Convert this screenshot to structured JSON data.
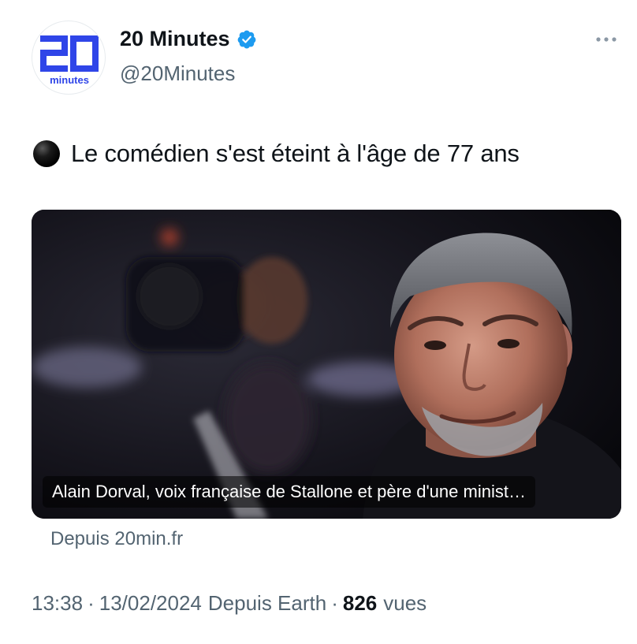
{
  "header": {
    "display_name": "20 Minutes",
    "handle": "@20Minutes",
    "avatar": {
      "logo_number": "20",
      "logo_word": "minutes",
      "brand_color": "#2f45e8"
    },
    "verified_icon": "verified-badge-icon",
    "more_icon": "more-options-icon"
  },
  "tweet": {
    "emoji": "black-circle",
    "text": "Le comédien s'est éteint à l'âge de 77 ans"
  },
  "card": {
    "caption": "Alain Dorval, voix française de Stallone et père d'une minist…",
    "source": "Depuis 20min.fr"
  },
  "meta": {
    "time": "13:38",
    "date": "13/02/2024",
    "via": "Depuis Earth",
    "views_count": "826",
    "views_label": "vues"
  },
  "colors": {
    "accent": "#1d9bf0",
    "secondary_text": "#536471",
    "primary_text": "#0f1419"
  }
}
